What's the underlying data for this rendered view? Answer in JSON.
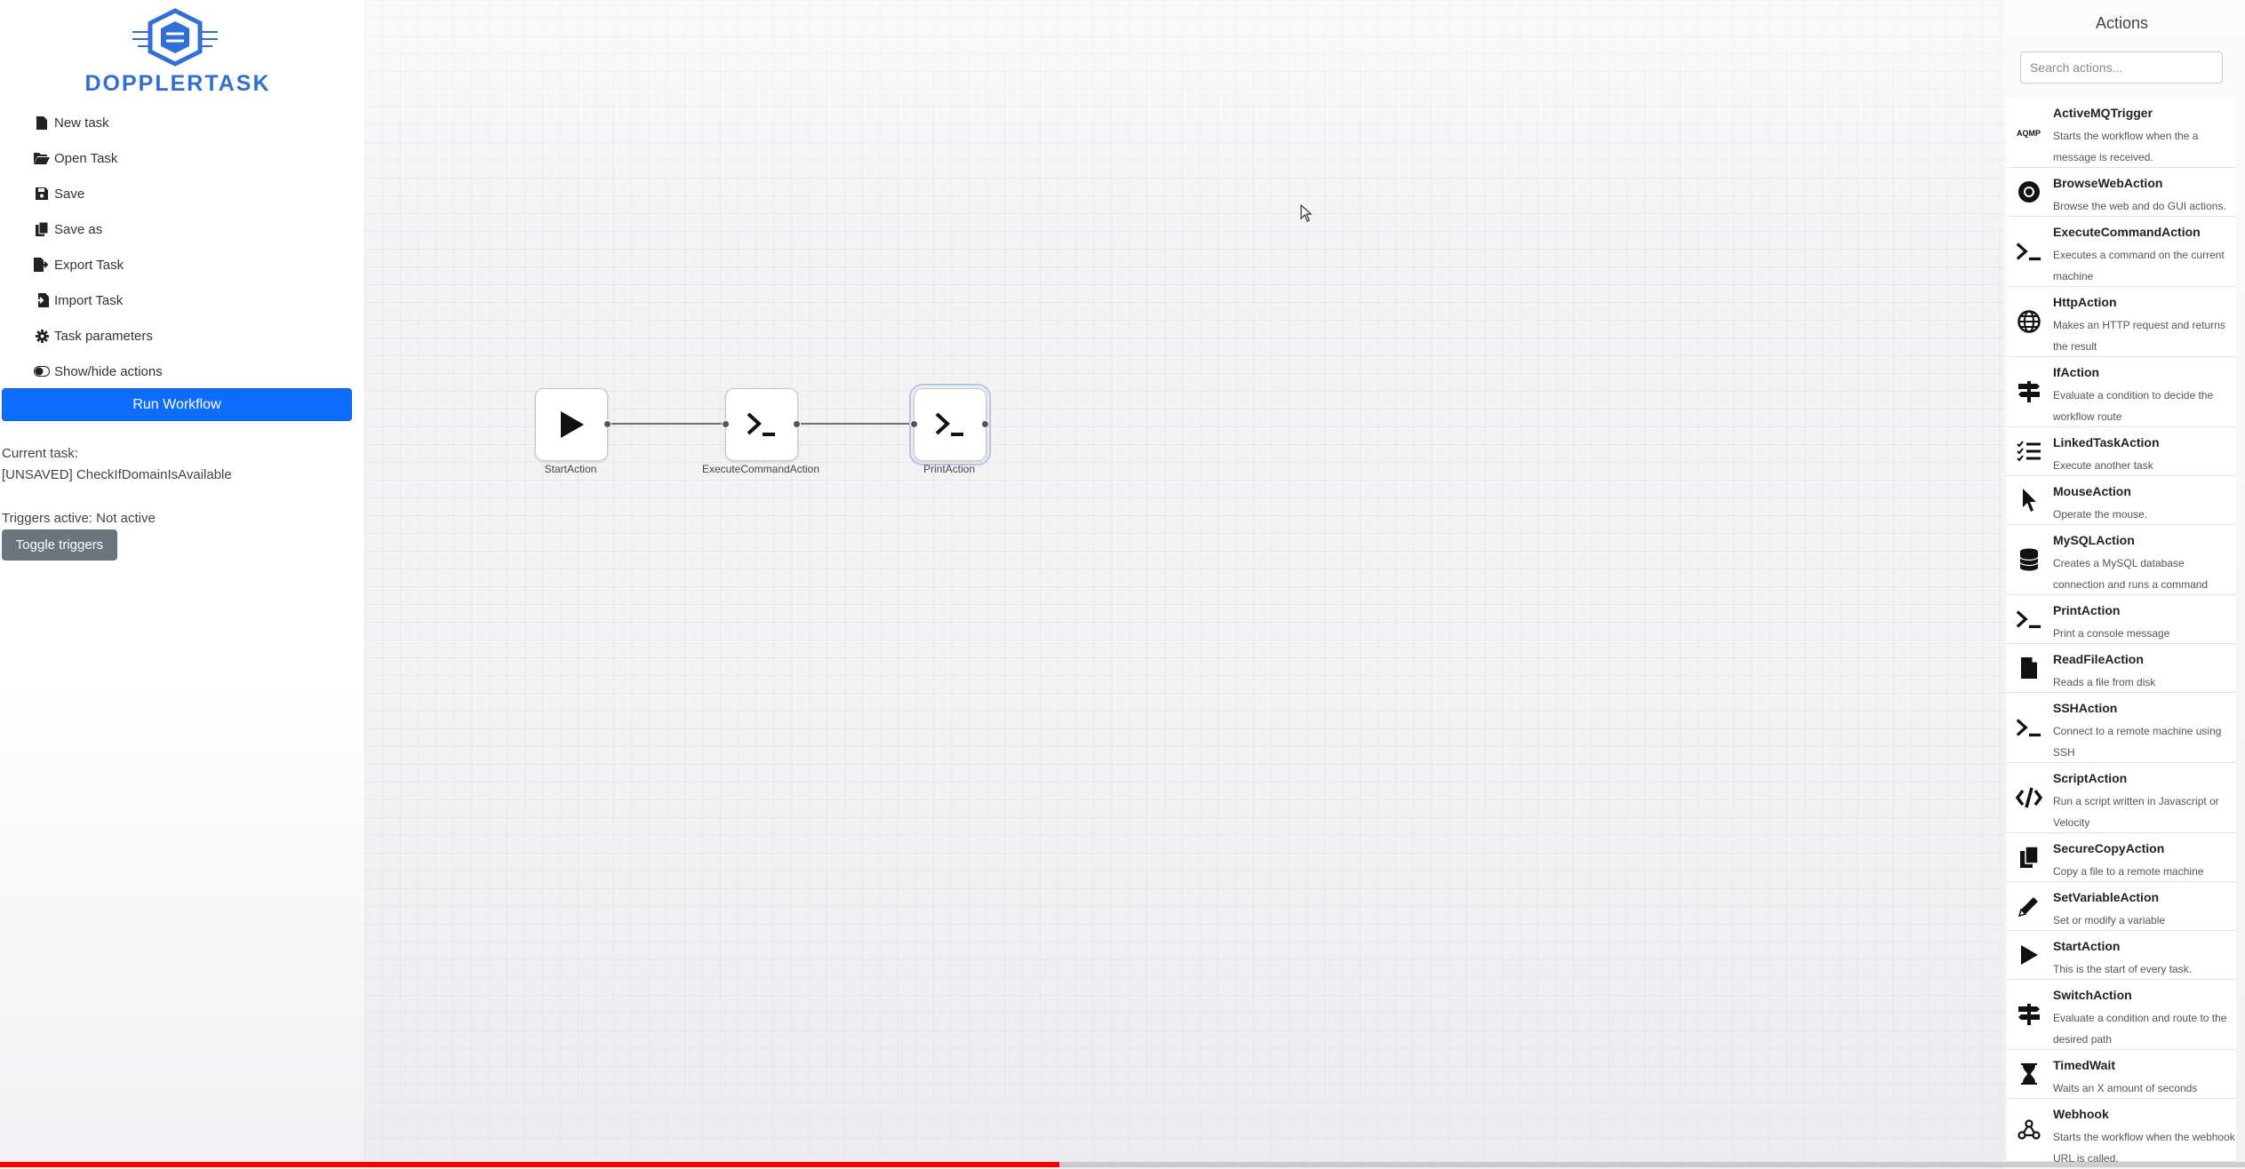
{
  "brand": {
    "logo_text": "DOPPLERTASK",
    "color": "#2f6fd6"
  },
  "menu": [
    {
      "label": "New task",
      "icon": "file-icon"
    },
    {
      "label": "Open Task",
      "icon": "folder-open-icon"
    },
    {
      "label": "Save",
      "icon": "save-icon"
    },
    {
      "label": "Save as",
      "icon": "copy-icon"
    },
    {
      "label": "Export Task",
      "icon": "export-icon"
    },
    {
      "label": "Import Task",
      "icon": "import-icon"
    },
    {
      "label": "Task parameters",
      "icon": "gear-icon"
    },
    {
      "label": "Show/hide actions",
      "icon": "toggle-icon"
    }
  ],
  "run_button": {
    "label": "Run Workflow",
    "color": "#0d6efd"
  },
  "current_task": {
    "label": "Current task:",
    "value": "[UNSAVED] CheckIfDomainIsAvailable"
  },
  "triggers": {
    "status_text": "Triggers active: Not active",
    "toggle_label": "Toggle triggers"
  },
  "workflow": {
    "nodes": [
      {
        "label": "StartAction",
        "icon": "play-icon"
      },
      {
        "label": "ExecuteCommandAction",
        "icon": "terminal-icon"
      },
      {
        "label": "PrintAction",
        "icon": "terminal-icon",
        "selected": true
      }
    ]
  },
  "actions_panel": {
    "title": "Actions",
    "search_placeholder": "Search actions...",
    "items": [
      {
        "name": "ActiveMQTrigger",
        "desc": "Starts the workflow when the a message is received.",
        "icon": "amqp-icon"
      },
      {
        "name": "BrowseWebAction",
        "desc": "Browse the web and do GUI actions.",
        "icon": "chrome-icon"
      },
      {
        "name": "ExecuteCommandAction",
        "desc": "Executes a command on the current machine",
        "icon": "terminal-icon"
      },
      {
        "name": "HttpAction",
        "desc": "Makes an HTTP request and returns the result",
        "icon": "globe-icon"
      },
      {
        "name": "IfAction",
        "desc": "Evaluate a condition to decide the workflow route",
        "icon": "signpost-icon"
      },
      {
        "name": "LinkedTaskAction",
        "desc": "Execute another task",
        "icon": "list-check-icon"
      },
      {
        "name": "MouseAction",
        "desc": "Operate the mouse.",
        "icon": "mouse-pointer-icon"
      },
      {
        "name": "MySQLAction",
        "desc": "Creates a MySQL database connection and runs a command",
        "icon": "database-icon"
      },
      {
        "name": "PrintAction",
        "desc": "Print a console message",
        "icon": "terminal-icon"
      },
      {
        "name": "ReadFileAction",
        "desc": "Reads a file from disk",
        "icon": "file-icon"
      },
      {
        "name": "SSHAction",
        "desc": "Connect to a remote machine using SSH",
        "icon": "terminal-icon"
      },
      {
        "name": "ScriptAction",
        "desc": "Run a script written in Javascript or Velocity",
        "icon": "code-icon"
      },
      {
        "name": "SecureCopyAction",
        "desc": "Copy a file to a remote machine",
        "icon": "copy-icon"
      },
      {
        "name": "SetVariableAction",
        "desc": "Set or modify a variable",
        "icon": "pencil-icon"
      },
      {
        "name": "StartAction",
        "desc": "This is the start of every task.",
        "icon": "play-icon"
      },
      {
        "name": "SwitchAction",
        "desc": "Evaluate a condition and route to the desired path",
        "icon": "signpost-icon"
      },
      {
        "name": "TimedWait",
        "desc": "Waits an X amount of seconds",
        "icon": "hourglass-icon"
      },
      {
        "name": "Webhook",
        "desc": "Starts the workflow when the webhook URL is called.",
        "icon": "webhook-icon"
      }
    ]
  },
  "video_progress": 0.472
}
